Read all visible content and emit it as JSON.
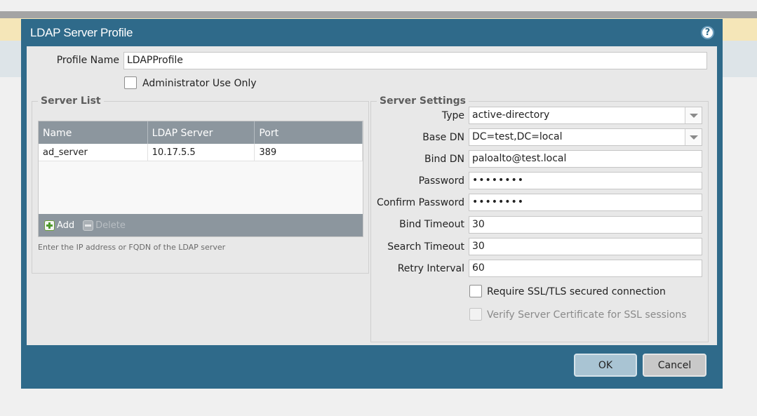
{
  "dialog": {
    "title": "LDAP Server Profile",
    "help_icon": "help-icon"
  },
  "profile": {
    "name_label": "Profile Name",
    "name_value": "LDAPProfile",
    "admin_only_label": "Administrator Use Only",
    "admin_only_checked": false
  },
  "server_list": {
    "legend": "Server List",
    "columns": [
      "Name",
      "LDAP Server",
      "Port"
    ],
    "rows": [
      [
        "ad_server",
        "10.17.5.5",
        "389"
      ]
    ],
    "add_label": "Add",
    "delete_label": "Delete",
    "hint": "Enter the IP address or FQDN of the LDAP server"
  },
  "server_settings": {
    "legend": "Server Settings",
    "type_label": "Type",
    "type_value": "active-directory",
    "base_dn_label": "Base DN",
    "base_dn_value": "DC=test,DC=local",
    "bind_dn_label": "Bind DN",
    "bind_dn_value": "paloalto@test.local",
    "password_label": "Password",
    "password_value": "••••••••",
    "confirm_password_label": "Confirm Password",
    "confirm_password_value": "••••••••",
    "bind_timeout_label": "Bind Timeout",
    "bind_timeout_value": "30",
    "search_timeout_label": "Search Timeout",
    "search_timeout_value": "30",
    "retry_interval_label": "Retry Interval",
    "retry_interval_value": "60",
    "ssl_label": "Require SSL/TLS secured connection",
    "ssl_checked": false,
    "verify_cert_label": "Verify Server Certificate for SSL sessions",
    "verify_cert_checked": false,
    "verify_cert_disabled": true
  },
  "buttons": {
    "ok": "OK",
    "cancel": "Cancel"
  },
  "colors": {
    "dialog_frame": "#2f6a8a",
    "table_header": "#8c969e",
    "add_icon": "#4f9a2b"
  }
}
